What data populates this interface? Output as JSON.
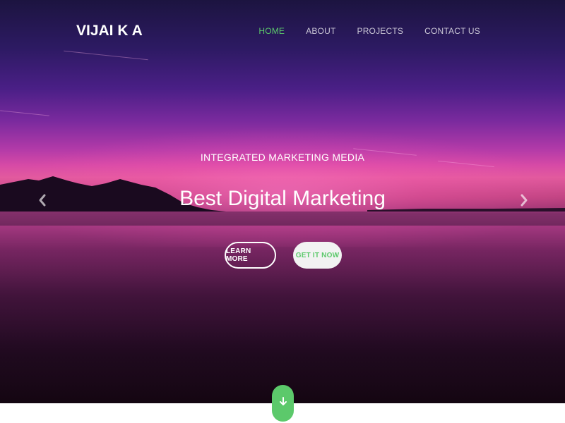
{
  "brand": {
    "name": "VIJAI K A"
  },
  "nav": {
    "items": [
      {
        "label": "HOME",
        "active": true
      },
      {
        "label": "ABOUT",
        "active": false
      },
      {
        "label": "PROJECTS",
        "active": false
      },
      {
        "label": "CONTACT US",
        "active": false
      }
    ]
  },
  "hero": {
    "subtitle": "INTEGRATED MARKETING MEDIA",
    "headline": "Best Digital Marketing",
    "buttons": {
      "primary_label": "LEARN MORE",
      "secondary_label": "GET IT NOW"
    }
  },
  "carousel": {
    "prev_icon": "chevron-left-icon",
    "next_icon": "chevron-right-icon"
  },
  "scroll": {
    "icon": "arrow-down-icon"
  },
  "colors": {
    "accent": "#5cc96b",
    "text_light": "#ffffff"
  }
}
